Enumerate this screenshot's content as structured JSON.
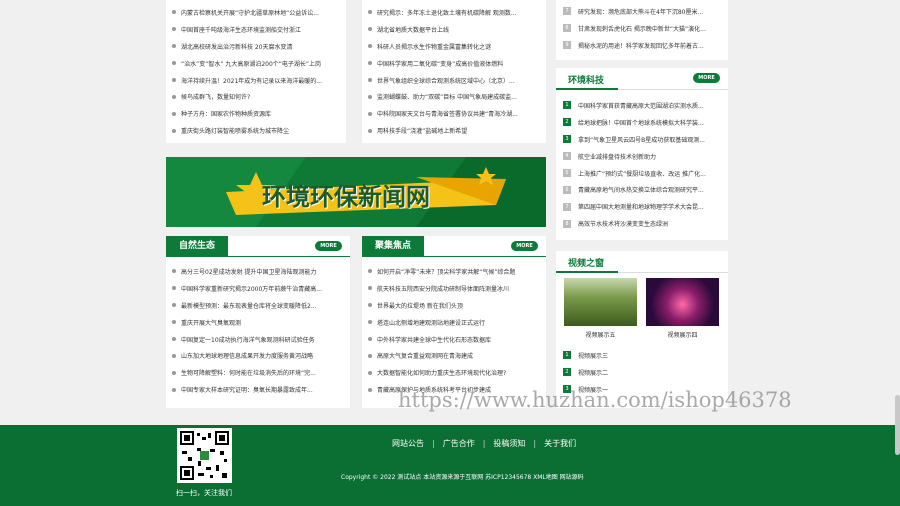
{
  "top_left_list": [
    "内蒙古检察机关开展“守护北疆草原林地”公益诉讼...",
    "中国首座千吨级海洋生态环境监测船交付浙江",
    "湖北高校研发出治污新科技 20天腐水变清",
    "“治水”变“智水” 九大高原湖泊200个“电子湖长”上岗",
    "海洋持续升温！2021年成为有记录以来海洋最暖的...",
    "候鸟成群飞，数量知何许?",
    "种子方舟：国家农作物种质资源库",
    "重庆街头路灯装智能喷雾系统为城市降尘"
  ],
  "top_mid_list": [
    "研究揭示：多年冻土退化致土壤有机碳降解 观测数...",
    "湖北省地质大数据平台上线",
    "科研人员揭示水生作物重金属富集转化之谜",
    "中国科学家用二氧化碳“变身”成高价值液体燃料",
    "世界气象组织全球综合观测系统区域中心（北京）...",
    "监测蝴蝶鼓、助力“双碳”目标 中国气象局建成碳监...",
    "中科院国家天文台与青海省签署协议共建“青海冷湖...",
    "用科技手段“浇灌”盐碱地上新希望"
  ],
  "top_right_list": [
    "研究发现：濒危底部大熊斗在4年下沉80厘米...",
    "甘肃发现刺舌虎化石 揭示晚中新世“大猫”演化...",
    "揭秘水泥的用途！科学家发现回忆多年前着古..."
  ],
  "banner": {
    "text": "环境环保新闻网"
  },
  "sections": {
    "more_label": "MORE",
    "nature": {
      "title": "自然生态",
      "items": [
        "高分三号02星成功发射 提升中国卫星海陆观测能力",
        "中国科学家重新研究揭示2000万年前蕨牛治青藏高...",
        "最新模型预测：最东现表量仓库将全球变暖降低2...",
        "重庆开展大气臭氧观测",
        "中国复定一10成功执行海洋气象观测科研试验任务",
        "山东加大地球地理信息成果开发力度服务黄河战略",
        "生物可降解塑料：何时能在垃圾消失后的环境“完...",
        "中国专家大样本研究证明：臭氧长期暴露致成年..."
      ]
    },
    "focus": {
      "title": "聚集焦点",
      "items": [
        "如何开启“净零”未来？顶尖科学家共解“气候”综合题",
        "航天科技五院西安分院成功研制导体面阵测量冰川",
        "世界最大的拉堤场 新在我们头顶",
        "塔连山北侧增地建观测站地建设正式运行",
        "中外科学家共建全球中生代化石形态数据库",
        "高原大气复合重益观测网在青海建成",
        "大数据智能化如何助力重庆生态环境现代化治理?",
        "青藏高原保护与地质系统科考平台初步建成"
      ]
    },
    "env_tech": {
      "title": "环境科技",
      "items": [
        "中国科学家首获青藏高原大范围湖泊实测水质...",
        "给地球把脉！中国首个地球系统模拟大科学装...",
        "拿到“气象卫星风云四号B星成功获取基础观测...",
        "航空业减排盘待技术创新助力",
        "上海推广“预约式”餐厨垃圾直收、改运 推广化...",
        "青藏高原地气间水热交换立体综合观测研究平...",
        "第四届中国大地测量和地球物理学学术大会昆...",
        "高效节水技术将沙漠变变生态绿洲"
      ]
    },
    "video": {
      "title": "视频之窗",
      "thumbs": [
        "视频展示五",
        "视频展示四"
      ],
      "items": [
        "视频展示三",
        "视频展示二",
        "视频展示一"
      ]
    }
  },
  "footer": {
    "links": [
      "网站公告",
      "广告合作",
      "投稿须知",
      "关于我们"
    ],
    "copyright": "Copyright © 2022 测试站点 本站资源来源于互联网 苏ICP12345678 XML地图 网站源码",
    "qr_caption": "扫一扫，关注我们"
  },
  "watermark": "https://www.huzhan.com/ishop46378"
}
